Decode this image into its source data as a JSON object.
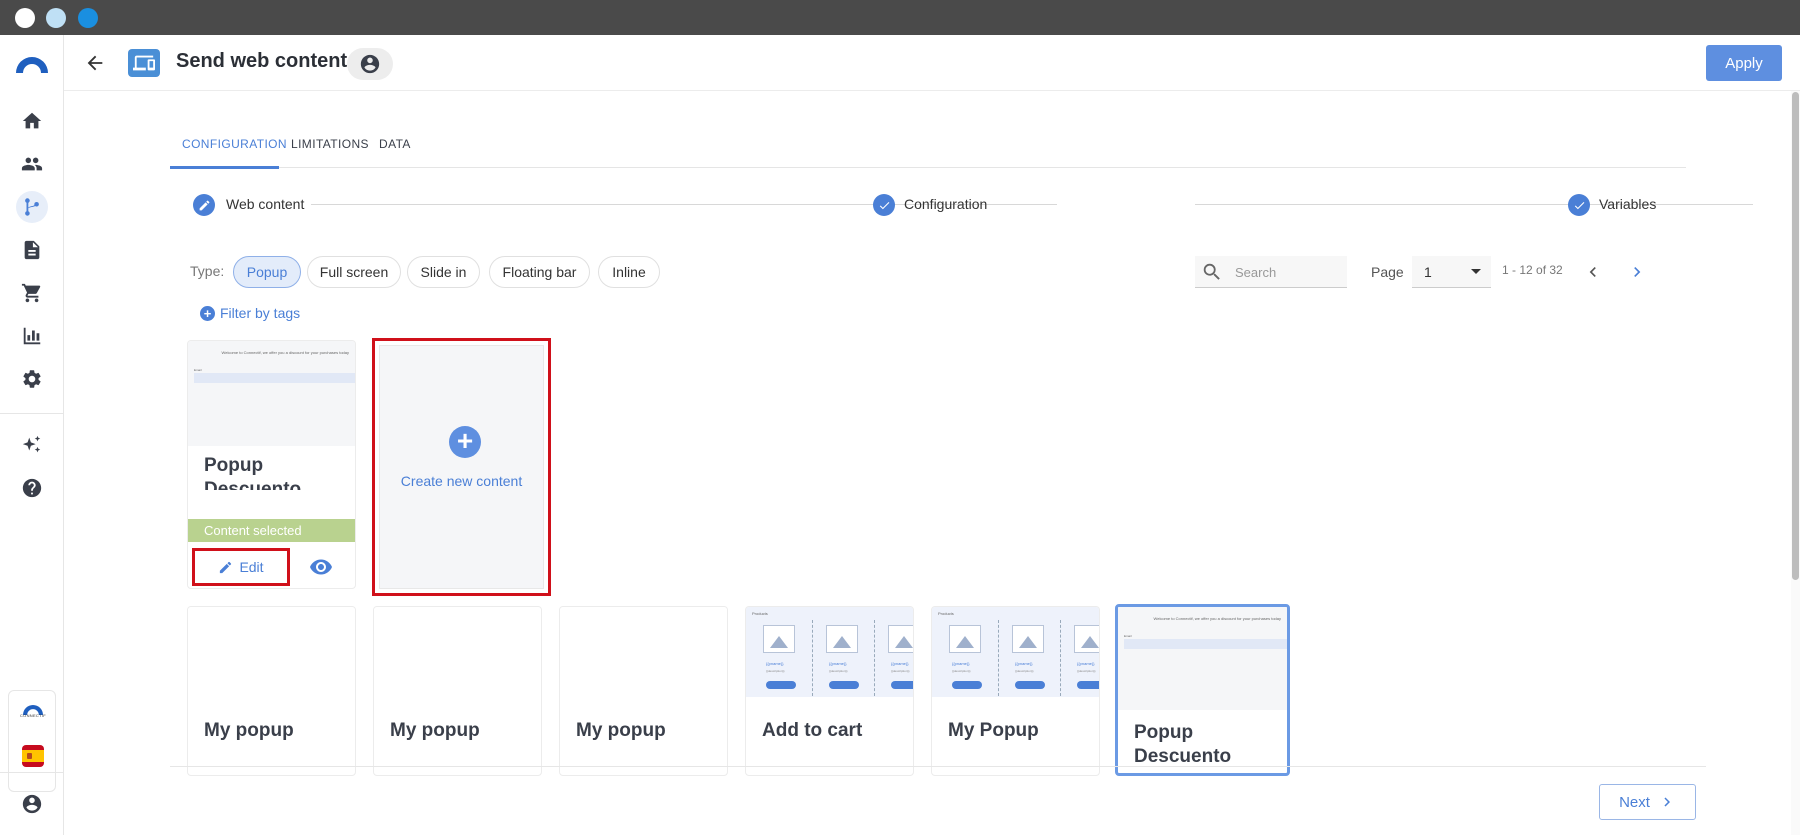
{
  "header": {
    "title": "Send web content",
    "apply_label": "Apply"
  },
  "sidebar": {
    "items": [
      {
        "icon": "home-icon"
      },
      {
        "icon": "people-icon"
      },
      {
        "icon": "flow-icon"
      },
      {
        "icon": "document-icon"
      },
      {
        "icon": "cart-icon"
      },
      {
        "icon": "chart-icon"
      },
      {
        "icon": "gear-icon"
      },
      {
        "icon": "sparkle-icon"
      },
      {
        "icon": "help-icon"
      }
    ],
    "brand_text": "CONNECTIF"
  },
  "tabs": [
    {
      "label": "CONFIGURATION"
    },
    {
      "label": "LIMITATIONS"
    },
    {
      "label": "DATA"
    }
  ],
  "stepper": {
    "steps": [
      {
        "label": "Web content"
      },
      {
        "label": "Configuration"
      },
      {
        "label": "Variables"
      }
    ]
  },
  "filters": {
    "type_label": "Type:",
    "types": [
      {
        "label": "Popup"
      },
      {
        "label": "Full screen"
      },
      {
        "label": "Slide in"
      },
      {
        "label": "Floating bar"
      },
      {
        "label": "Inline"
      }
    ],
    "search_placeholder": "Search",
    "page_label": "Page",
    "page_value": "1",
    "range_text": "1 - 12 of 32",
    "filter_tags_label": "Filter by tags"
  },
  "cards": {
    "first": {
      "title": "Popup Descuento",
      "thumb_text": "Welcome to Connectif, we offer you a discount for your purchases today",
      "thumb_field": "Email",
      "selected_label": "Content selected",
      "edit_label": "Edit"
    },
    "create": {
      "label": "Create new content"
    },
    "row2": [
      {
        "title": "My popup"
      },
      {
        "title": "My popup"
      },
      {
        "title": "My popup"
      },
      {
        "title": "Add to cart",
        "thumb_label": "Products",
        "product_name": "{{pname}}",
        "product_desc": "{{description}}"
      },
      {
        "title": "My Popup",
        "thumb_label": "Products",
        "product_name": "{{pname}}",
        "product_desc": "{{description}}"
      },
      {
        "title": "Popup Descuento",
        "thumb_text": "Welcome to Connectif, we offer you a discount for your purchases today",
        "thumb_field": "Email"
      }
    ]
  },
  "footer": {
    "next_label": "Next"
  },
  "colors": {
    "accent": "#4a7fd6",
    "apply_bg": "#5e8fe0",
    "selected_green": "#b9d28f",
    "highlight_red": "#d0101a"
  }
}
